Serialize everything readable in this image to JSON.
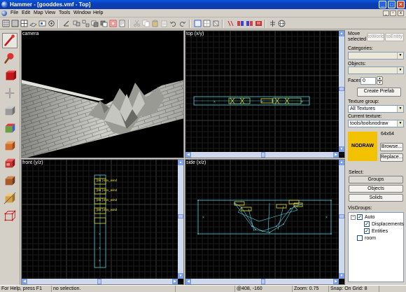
{
  "window": {
    "title": "Hammer - [gooddes.vmf - Top]"
  },
  "menu": [
    "File",
    "Edit",
    "Map",
    "View",
    "Tools",
    "Window",
    "Help"
  ],
  "viewports": {
    "camera": "camera",
    "top": "top (x/y)",
    "front": "front (y/z)",
    "side": "side (x/z)"
  },
  "front_labels": [
    "[66 ] env_wind",
    "[66 ] env_wind",
    "[66 ] env_wind",
    "[66 ] env_wind"
  ],
  "right": {
    "move_selected": "Move\nselected",
    "to_world": "toWorld",
    "to_entity": "toEntity",
    "categories_label": "Categories:",
    "objects_label": "Objects:",
    "faces_label": "Faces:",
    "faces_value": "0",
    "create_prefab": "Create Prefab",
    "texture_group_label": "Texture group:",
    "texture_group_value": "All Textures",
    "current_texture_label": "Current texture:",
    "current_texture_value": "tools/toolsnodraw",
    "texture_size": "64x64",
    "texture_swatch_text": "NODRAW",
    "texture_swatch_color": "#f2c200",
    "browse": "Browse...",
    "replace": "Replace...",
    "select_label": "Select:",
    "groups": "Groups",
    "objects": "Objects",
    "solids": "Solids",
    "visgroups_label": "VisGroups:",
    "visgroups": [
      {
        "label": "Auto",
        "checked": true,
        "level": 0
      },
      {
        "label": "Displacements",
        "checked": true,
        "level": 1
      },
      {
        "label": "Entities",
        "checked": true,
        "level": 1
      },
      {
        "label": "room",
        "checked": false,
        "level": 0
      }
    ]
  },
  "status": {
    "help": "For Help, press F1",
    "selection": "no selection.",
    "coords": "@408, -160",
    "zoom": "Zoom: 0.75",
    "snap": "Snap: On Grid: 8"
  },
  "colors": {
    "grid": "#1c1c1c",
    "grid_major": "#3a3a3a",
    "geometry": "#5ad2e0",
    "entity": "#e8e23c",
    "selection_blue": "#2f5bd8"
  }
}
